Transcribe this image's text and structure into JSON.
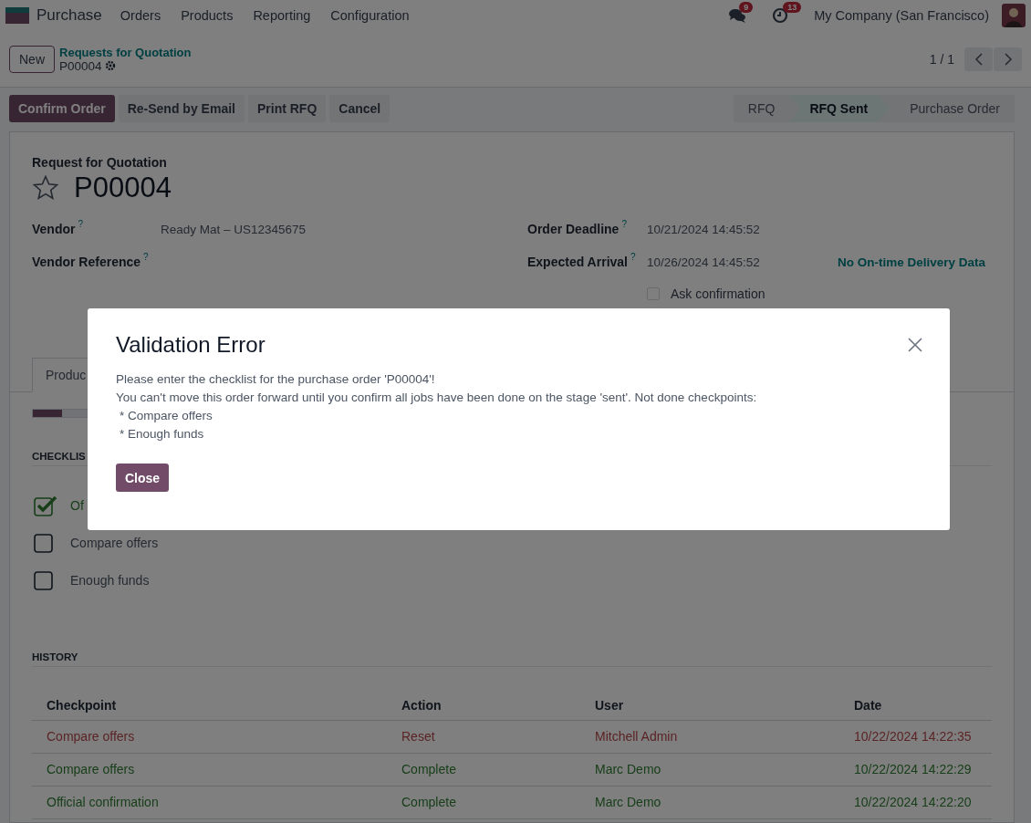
{
  "navbar": {
    "app": "Purchase",
    "menu": [
      "Orders",
      "Products",
      "Reporting",
      "Configuration"
    ],
    "messages_badge": "9",
    "activities_badge": "13",
    "company": "My Company (San Francisco)"
  },
  "control_panel": {
    "new_button": "New",
    "breadcrumb": "Requests for Quotation",
    "record": "P00004",
    "pager": "1 / 1"
  },
  "actions": [
    {
      "label": "Confirm Order",
      "primary": true
    },
    {
      "label": "Re-Send by Email",
      "primary": false
    },
    {
      "label": "Print RFQ",
      "primary": false
    },
    {
      "label": "Cancel",
      "primary": false
    }
  ],
  "stages": [
    {
      "label": "RFQ",
      "selected": false
    },
    {
      "label": "RFQ Sent",
      "selected": true
    },
    {
      "label": "Purchase Order",
      "selected": false
    }
  ],
  "form": {
    "subtitle": "Request for Quotation",
    "starred": false,
    "name": "P00004",
    "left_fields": [
      {
        "label": "Vendor",
        "help": "?",
        "value": "Ready Mat – US12345675"
      },
      {
        "label": "Vendor Reference",
        "help": "?"
      }
    ],
    "right_fields": [
      {
        "label": "Order Deadline",
        "help": "?",
        "value": "10/21/2024 14:45:52"
      },
      {
        "label": "Expected Arrival",
        "help": "?",
        "value": "10/26/2024 14:45:52",
        "extra": "No On-time Delivery Data"
      }
    ],
    "ask_confirmation": {
      "label": "Ask confirmation",
      "checked": false
    },
    "tabs": [
      {
        "label": "Produc",
        "selected": true
      }
    ],
    "progress": {
      "level": 0.33
    },
    "checklist_title": "CHECKLIS",
    "checklist": [
      {
        "label": "Of",
        "checked": true
      },
      {
        "label": "Compare offers",
        "checked": false
      },
      {
        "label": "Enough funds",
        "checked": false
      }
    ],
    "history": {
      "title": "HISTORY",
      "columns": [
        "Checkpoint",
        "Action",
        "User",
        "Date"
      ],
      "rows": [
        {
          "kind": "reset",
          "cells": [
            "Compare offers",
            "Reset",
            "Mitchell Admin",
            "10/22/2024 14:22:35"
          ]
        },
        {
          "kind": "complete",
          "cells": [
            "Compare offers",
            "Complete",
            "Marc Demo",
            "10/22/2024 14:22:29"
          ]
        },
        {
          "kind": "complete",
          "cells": [
            "Official confirmation",
            "Complete",
            "Marc Demo",
            "10/22/2024 14:22:20"
          ]
        }
      ]
    }
  },
  "dialog": {
    "title": "Validation Error",
    "lines": [
      "Please enter the checklist for the purchase order 'P00004'!",
      "You can't move this order forward until you confirm all jobs have been done on the stage 'sent'. Not done checkpoints:",
      "* Compare offers",
      "* Enough funds"
    ],
    "close_button": "Close"
  }
}
